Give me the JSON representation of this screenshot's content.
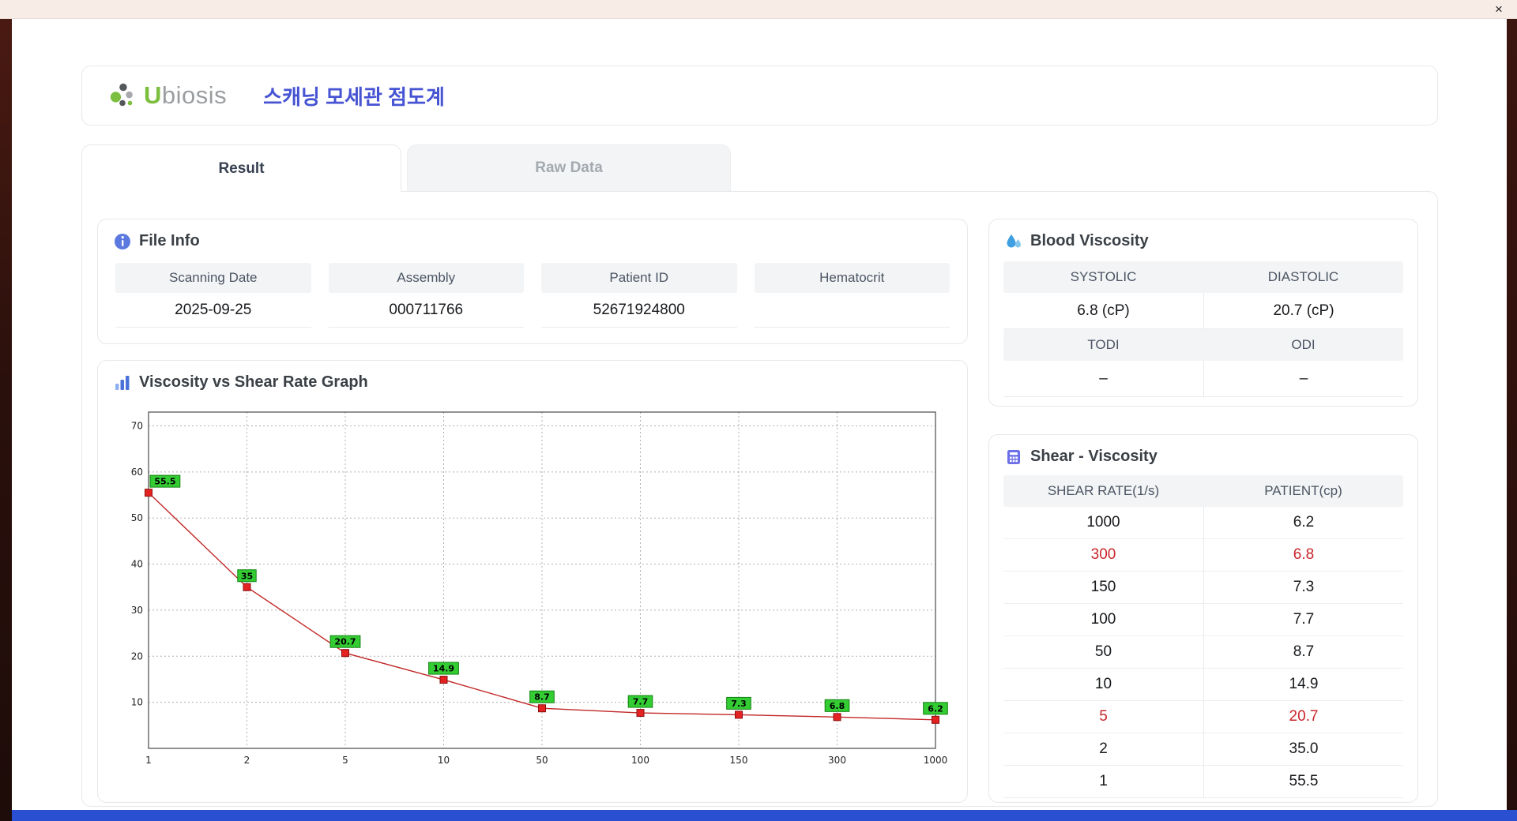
{
  "window": {
    "close_label": "×"
  },
  "header": {
    "logo_u": "U",
    "logo_rest": "biosis",
    "app_title": "스캐닝 모세관 점도계"
  },
  "tabs": [
    {
      "label": "Result",
      "active": true
    },
    {
      "label": "Raw Data",
      "active": false
    }
  ],
  "file_info": {
    "title": "File Info",
    "fields": [
      {
        "label": "Scanning Date",
        "value": "2025-09-25"
      },
      {
        "label": "Assembly",
        "value": "000711766"
      },
      {
        "label": "Patient ID",
        "value": "52671924800"
      },
      {
        "label": "Hematocrit",
        "value": ""
      }
    ]
  },
  "blood_viscosity": {
    "title": "Blood Viscosity",
    "row1_headers": [
      "SYSTOLIC",
      "DIASTOLIC"
    ],
    "row1_values": [
      "6.8 (cP)",
      "20.7 (cP)"
    ],
    "row2_headers": [
      "TODI",
      "ODI"
    ],
    "row2_values": [
      "–",
      "–"
    ]
  },
  "graph": {
    "title": "Viscosity vs Shear Rate Graph"
  },
  "shear_table": {
    "title": "Shear - Viscosity",
    "headers": [
      "SHEAR RATE(1/s)",
      "PATIENT(cp)"
    ],
    "rows": [
      {
        "shear": "1000",
        "patient": "6.2",
        "highlight": false
      },
      {
        "shear": "300",
        "patient": "6.8",
        "highlight": true
      },
      {
        "shear": "150",
        "patient": "7.3",
        "highlight": false
      },
      {
        "shear": "100",
        "patient": "7.7",
        "highlight": false
      },
      {
        "shear": "50",
        "patient": "8.7",
        "highlight": false
      },
      {
        "shear": "10",
        "patient": "14.9",
        "highlight": false
      },
      {
        "shear": "5",
        "patient": "20.7",
        "highlight": true
      },
      {
        "shear": "2",
        "patient": "35.0",
        "highlight": false
      },
      {
        "shear": "1",
        "patient": "55.5",
        "highlight": false
      }
    ]
  },
  "chart_data": {
    "type": "line",
    "title": "Viscosity vs Shear Rate Graph",
    "xlabel": "",
    "ylabel": "",
    "x_categories": [
      "1",
      "2",
      "5",
      "10",
      "50",
      "100",
      "150",
      "300",
      "1000"
    ],
    "values": [
      55.5,
      35,
      20.7,
      14.9,
      8.7,
      7.7,
      7.3,
      6.8,
      6.2
    ],
    "point_labels": [
      "55.5",
      "35",
      "20.7",
      "14.9",
      "8.7",
      "7.7",
      "7.3",
      "6.8",
      "6.2"
    ],
    "ylim": [
      0,
      73
    ],
    "yticks": [
      10,
      20,
      30,
      40,
      50,
      60,
      70
    ],
    "grid": true,
    "line_color": "#c22727",
    "marker_color": "#e42222",
    "marker_stroke": "#8d0f0f",
    "label_bg": "#33cc33",
    "label_stroke": "#128212"
  }
}
